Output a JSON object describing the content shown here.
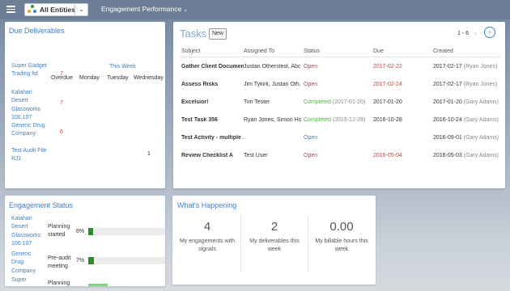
{
  "topbar": {
    "entity_label": "All Entities",
    "dashboard_title": "Engagement Performance"
  },
  "due": {
    "title": "Due Deliverables",
    "this_week": "This Week",
    "headers": [
      "Overdue",
      "Monday",
      "Tuesday",
      "Wednesday"
    ],
    "rows": [
      {
        "name": "Super Gadget Trading ltd",
        "overdue": "7",
        "wednesday": ""
      },
      {
        "name": "Kalahari Desert Glassworks 100.107",
        "overdue": "7",
        "wednesday": ""
      },
      {
        "name": "Generic Drug Company",
        "overdue": "6",
        "wednesday": ""
      },
      {
        "name": "Test Audit File RJ1",
        "overdue": "",
        "wednesday": "1"
      }
    ]
  },
  "tasks": {
    "title": "Tasks",
    "new_label": "New",
    "pager": "1 - 6",
    "headers": {
      "subject": "Subject",
      "assigned": "Assigned To",
      "status": "Status",
      "due": "Due",
      "created": "Created"
    },
    "rows": [
      {
        "subject": "Gather Client Documen...",
        "assigned": "Justan Otherstest, Abc...",
        "status": "Open",
        "status_extra": "",
        "due": "2017-02-22",
        "due_overdue": true,
        "created": "2017-02-17",
        "created_by": "(Ryan Jones)"
      },
      {
        "subject": "Assess Risks",
        "assigned": "Jim Tykirk, Justan Oth...",
        "status": "Open",
        "status_extra": "",
        "due": "2017-02-24",
        "due_overdue": true,
        "created": "2017-02-17",
        "created_by": "(Ryan Jones)"
      },
      {
        "subject": "Excelsior!",
        "assigned": "Tim Tester",
        "status": "Completed",
        "status_extra": "(2017-01-20)",
        "due": "2017-01-20",
        "due_overdue": false,
        "created": "2017-01-20",
        "created_by": "(Gary Adams)"
      },
      {
        "subject": "Test Task 356",
        "assigned": "Ryan Jones, Simon Ho...",
        "status": "Completed",
        "status_extra": "(2016-12-28)",
        "due": "2016-10-28",
        "due_overdue": false,
        "created": "2016-10-24",
        "created_by": "(Gary Adams)"
      },
      {
        "subject": "Test Activity - multiple ...",
        "assigned": "",
        "status": "Open",
        "status_extra": "",
        "due": "",
        "due_overdue": false,
        "created": "2016-09-01",
        "created_by": "(Gary Adams)"
      },
      {
        "subject": "Review Checklist A",
        "assigned": "Test User",
        "status": "Open",
        "status_extra": "",
        "due": "2016-05-04",
        "due_overdue": true,
        "created": "2016-05-03",
        "created_by": "(Gary Adams)"
      }
    ]
  },
  "engagement": {
    "title": "Engagement Status",
    "rows": [
      {
        "name": "Kalahari Desert Glassworks 100.107",
        "phase": "Planning started",
        "pct": "6%",
        "fraction": 0.06
      },
      {
        "name": "Generic Drug Company",
        "phase": "Pre-audit meeting",
        "pct": "7%",
        "fraction": 0.07
      },
      {
        "name": "Super",
        "phase": "Planning",
        "pct": "",
        "fraction": 0.25
      }
    ]
  },
  "happening": {
    "title": "What's Happening",
    "stats": [
      {
        "value": "4",
        "label": "My engagements with signals"
      },
      {
        "value": "2",
        "label": "My deliverables this week"
      },
      {
        "value": "0.00",
        "label": "My billable hours this week"
      }
    ]
  },
  "colors": {
    "accent": "#3f7fc6",
    "overdue": "#d9363e",
    "completed": "#5aae4a",
    "progress": "#2e8b2e"
  }
}
